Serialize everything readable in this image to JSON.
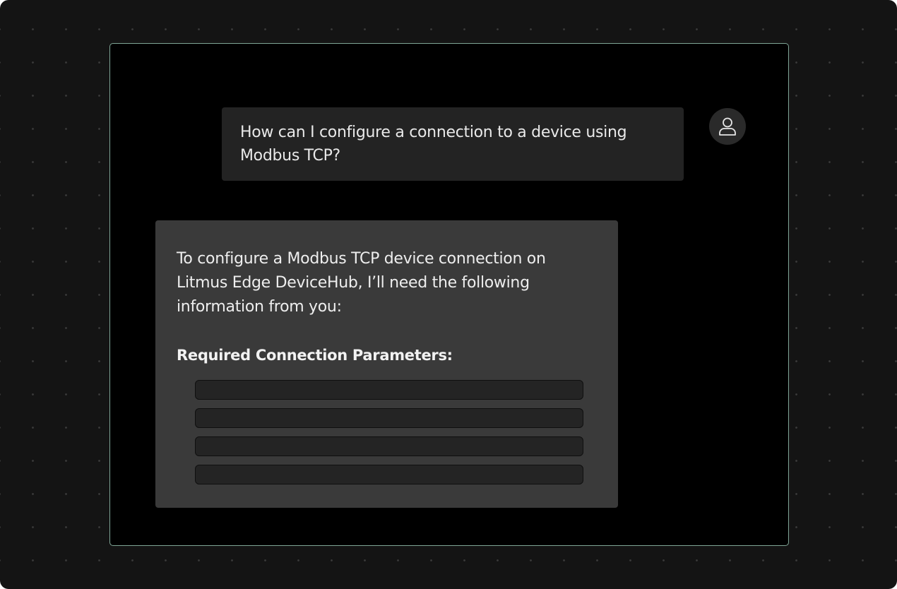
{
  "chat": {
    "user_message": "How can I configure a connection to a device using Modbus TCP?",
    "user_avatar_icon": "user-icon",
    "assistant_message": "To configure a Modbus TCP device connection on Litmus Edge DeviceHub, I’ll need the following information from you:",
    "params_heading": "Required Connection Parameters:",
    "param_placeholder_count": 4
  },
  "colors": {
    "background": "#141414",
    "window": "#000000",
    "window_border": "#7fa596",
    "user_bubble": "#232323",
    "assistant_bubble": "#3a3a3a"
  }
}
